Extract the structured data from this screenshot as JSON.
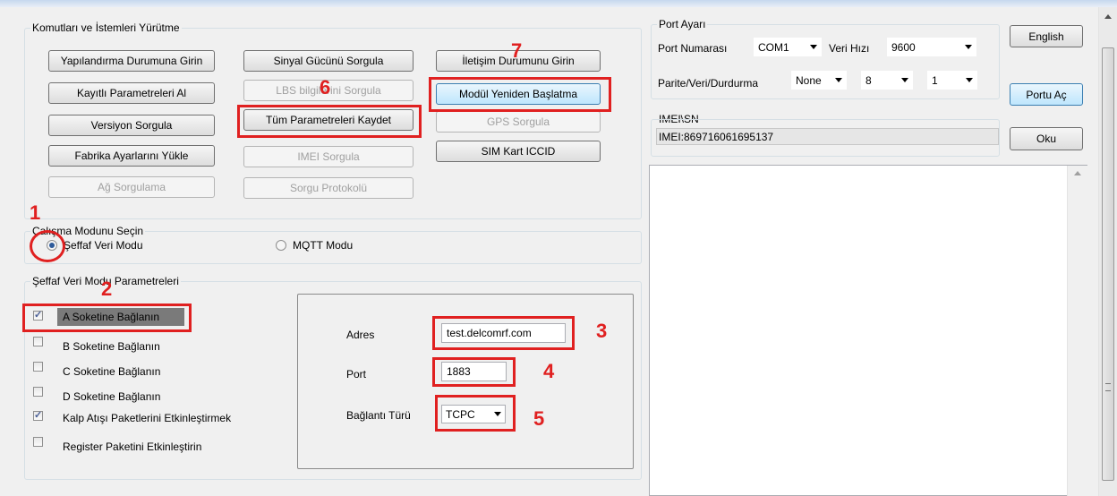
{
  "commands": {
    "legend": "Komutları ve İstemleri Yürütme",
    "buttons": {
      "config_enter": "Yapılandırma Durumuna Girin",
      "saved_params": "Kayıtlı Parametreleri Al",
      "version_query": "Versiyon Sorgula",
      "factory_load": "Fabrika Ayarlarını Yükle",
      "network_query": "Ağ Sorgulama",
      "signal_query": "Sinyal Gücünü Sorgula",
      "lbs_query": "LBS bilgilerini Sorgula",
      "save_all": "Tüm Parametreleri Kaydet",
      "imei_query": "IMEI Sorgula",
      "protocol_query": "Sorgu Protokolü",
      "comm_enter": "İletişim Durumunu Girin",
      "module_restart": "Modül Yeniden Başlatma",
      "gps_query": "GPS Sorgula",
      "sim_iccid": "SIM Kart ICCID"
    }
  },
  "work_mode": {
    "legend": "Çalışma Modunu Seçin",
    "options": [
      "Şeffaf Veri Modu",
      "MQTT Modu"
    ],
    "selected": "Şeffaf Veri Modu"
  },
  "transparent": {
    "legend": "Şeffaf Veri Modu Parametreleri",
    "checks": [
      {
        "label": "A Soketine Bağlanın",
        "checked": true
      },
      {
        "label": "B Soketine Bağlanın",
        "checked": false
      },
      {
        "label": "C Soketine Bağlanın",
        "checked": false
      },
      {
        "label": "D Soketine Bağlanın",
        "checked": false
      },
      {
        "label": "Kalp Atışı Paketlerini Etkinleştirmek",
        "checked": true
      },
      {
        "label": "Register Paketini Etkinleştirin",
        "checked": false
      }
    ],
    "address_label": "Adres",
    "address_value": "test.delcomrf.com",
    "port_label": "Port",
    "port_value": "1883",
    "conn_type_label": "Bağlantı Türü",
    "conn_type_value": "TCPC"
  },
  "port_settings": {
    "legend": "Port Ayarı",
    "port_no_label": "Port Numarası",
    "port_no_value": "COM1",
    "baud_label": "Veri Hızı",
    "baud_value": "9600",
    "parity_label": "Parite/Veri/Durdurma",
    "parity_value": "None",
    "data_bits": "8",
    "stop_bits": "1"
  },
  "imei": {
    "legend": "IMEI\\SN",
    "value": "IMEI:869716061695137"
  },
  "side_buttons": {
    "english": "English",
    "open_port": "Portu Aç",
    "read": "Oku"
  },
  "annotations": [
    "1",
    "2",
    "3",
    "4",
    "5",
    "6",
    "7"
  ],
  "colors": {
    "annotation": "#e02020",
    "background": "#f0f0f0"
  }
}
